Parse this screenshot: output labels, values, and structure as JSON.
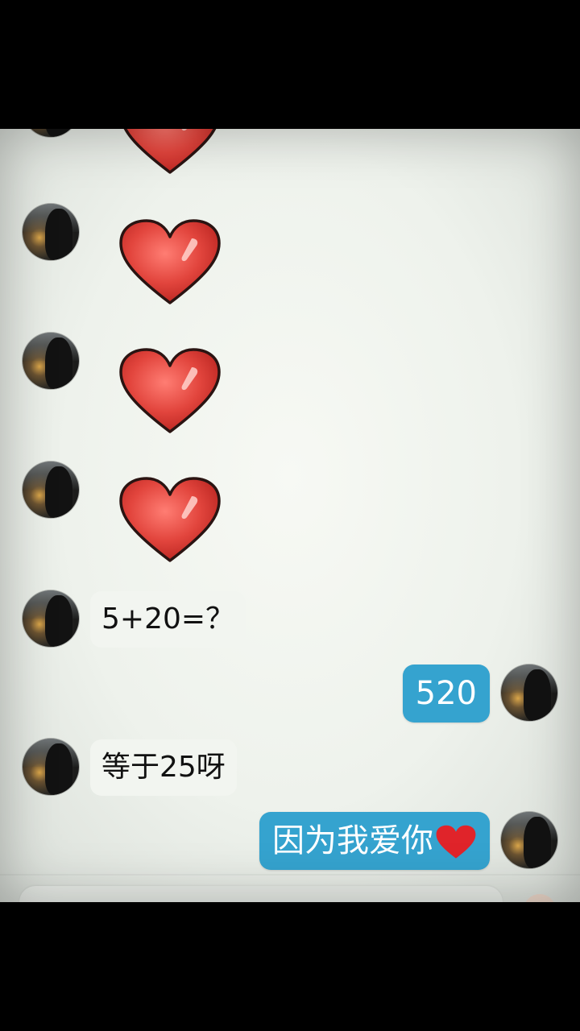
{
  "messages": [
    {
      "side": "in",
      "type": "sticker",
      "sticker": "red-heart"
    },
    {
      "side": "in",
      "type": "sticker",
      "sticker": "red-heart"
    },
    {
      "side": "in",
      "type": "sticker",
      "sticker": "red-heart"
    },
    {
      "side": "in",
      "type": "sticker",
      "sticker": "red-heart"
    },
    {
      "side": "in",
      "type": "text",
      "text": "5+20=？"
    },
    {
      "side": "out",
      "type": "text",
      "text": "520"
    },
    {
      "side": "in",
      "type": "text",
      "text": "等于25呀"
    },
    {
      "side": "out",
      "type": "text",
      "text": "因为我爱你",
      "trailing_emoji": "red-heart"
    }
  ],
  "colors": {
    "outgoing_bubble": "#35a3cf",
    "incoming_bubble": "#f2f5f0",
    "heart": "#e0403a"
  }
}
